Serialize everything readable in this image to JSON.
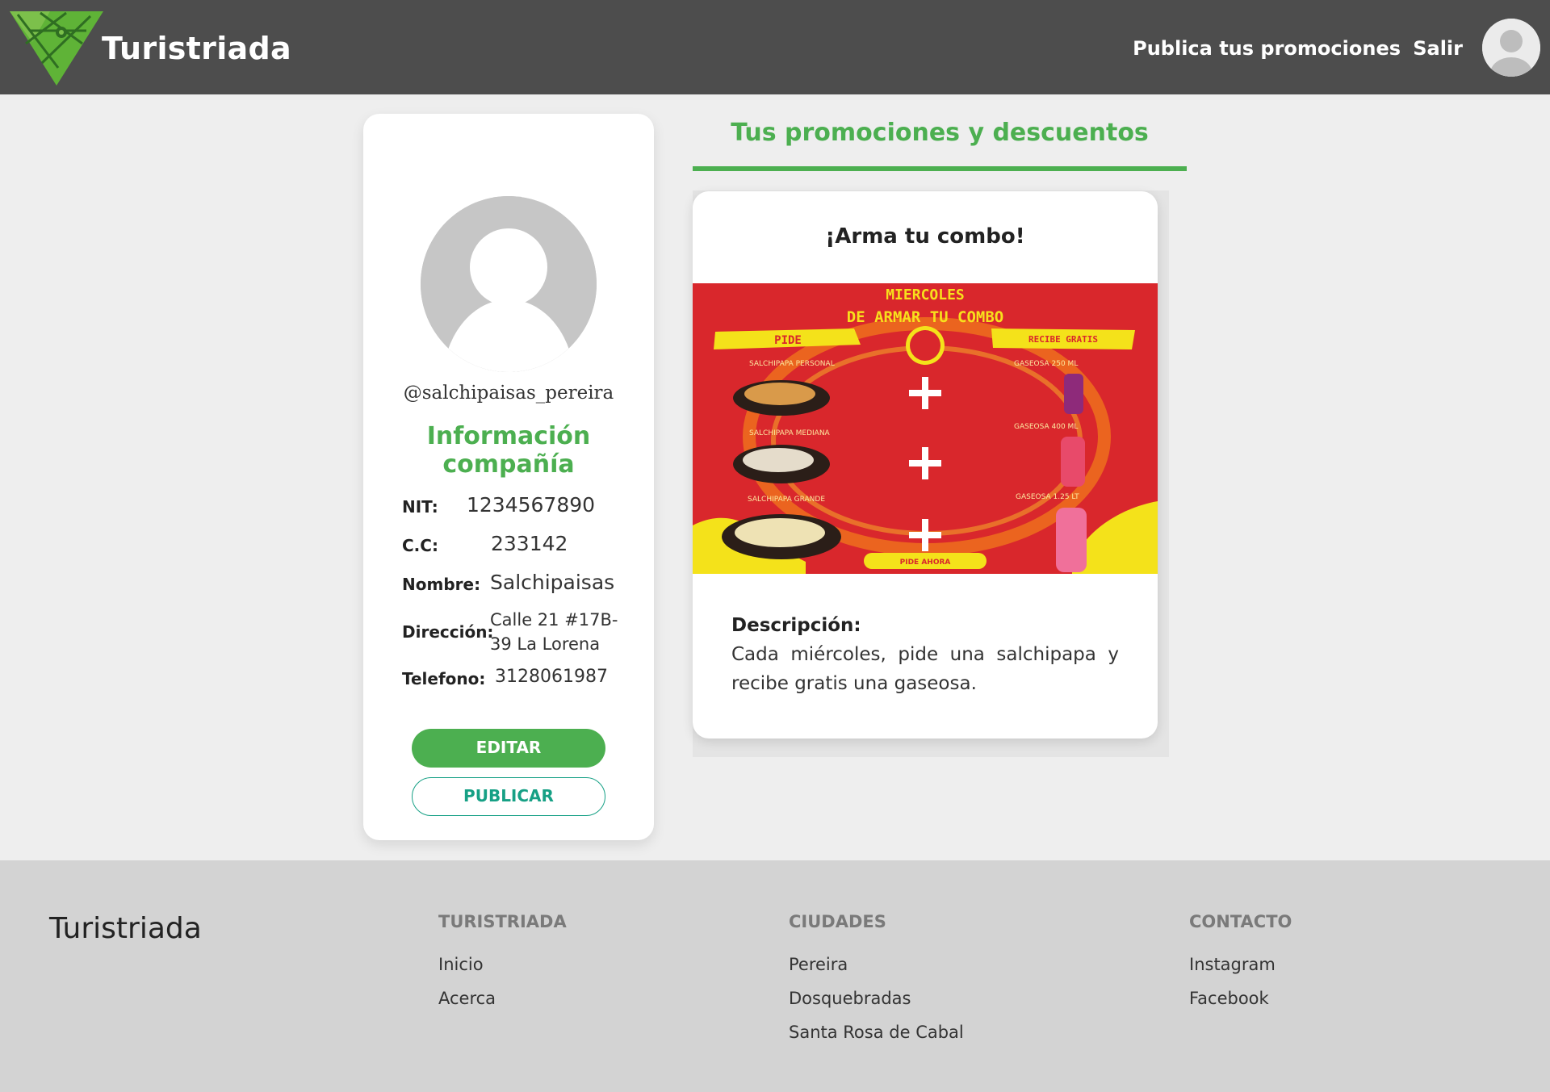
{
  "header": {
    "brand": "Turistriada",
    "nav": {
      "publish_promos": "Publica tus promociones",
      "logout": "Salir"
    }
  },
  "profile": {
    "username": "@salchipaisas_pereira",
    "section_title": "Información compañía",
    "fields": {
      "nit": {
        "label": "NIT:",
        "value": "1234567890"
      },
      "cc": {
        "label": "C.C:",
        "value": "233142"
      },
      "name": {
        "label": "Nombre:",
        "value": "Salchipaisas"
      },
      "address": {
        "label": "Dirección:",
        "value": "Calle 21 #17B-39 La Lorena"
      },
      "phone": {
        "label": "Telefono:",
        "value": "3128061987"
      }
    },
    "buttons": {
      "edit": "EDITAR",
      "publish": "PUBLICAR"
    }
  },
  "promotions": {
    "header": "Tus promociones y descuentos",
    "card": {
      "title": "¡Arma tu combo!",
      "image": {
        "headline_1": "MIERCOLES",
        "headline_2": "DE ARMAR TU COMBO",
        "left_tag": "PIDE",
        "right_tag": "RECIBE GRATIS",
        "items_left": [
          "SALCHIPAPA PERSONAL",
          "SALCHIPAPA MEDIANA",
          "SALCHIPAPA GRANDE"
        ],
        "items_right": [
          "GASEOSA 250 ML",
          "GASEOSA 400 ML",
          "GASEOSA 1.25 LT"
        ],
        "cta": "PIDE AHORA"
      },
      "description_label": "Descripción:",
      "description": "Cada miércoles, pide una salchipapa y recibe gratis una gaseosa."
    }
  },
  "footer": {
    "brand": "Turistriada",
    "columns": [
      {
        "title": "TURISTRIADA",
        "links": [
          "Inicio",
          "Acerca"
        ]
      },
      {
        "title": "CIUDADES",
        "links": [
          "Pereira",
          "Dosquebradas",
          "Santa Rosa de Cabal"
        ]
      },
      {
        "title": "CONTACTO",
        "links": [
          "Instagram",
          "Facebook"
        ]
      }
    ]
  },
  "colors": {
    "header_bg": "#4d4d4d",
    "accent_green": "#4caf50",
    "teal": "#16a085",
    "footer_bg": "#d3d3d3",
    "page_bg": "#eeeeee"
  },
  "icons": [
    "turistriada-logo-icon",
    "user-avatar-icon"
  ]
}
